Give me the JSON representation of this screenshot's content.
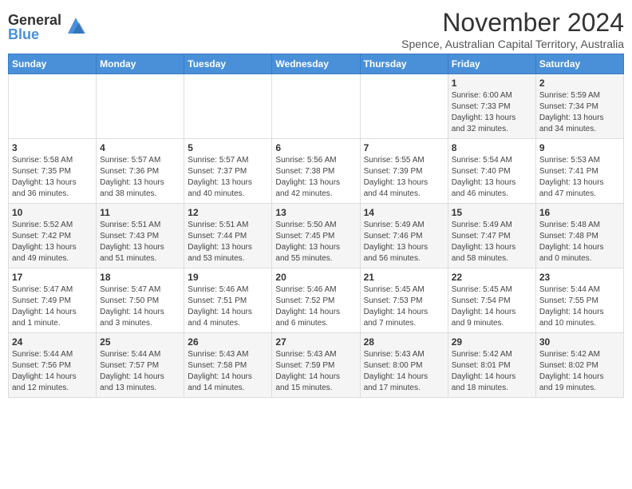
{
  "logo": {
    "general": "General",
    "blue": "Blue"
  },
  "title": "November 2024",
  "location": "Spence, Australian Capital Territory, Australia",
  "days_of_week": [
    "Sunday",
    "Monday",
    "Tuesday",
    "Wednesday",
    "Thursday",
    "Friday",
    "Saturday"
  ],
  "weeks": [
    [
      {
        "day": "",
        "info": ""
      },
      {
        "day": "",
        "info": ""
      },
      {
        "day": "",
        "info": ""
      },
      {
        "day": "",
        "info": ""
      },
      {
        "day": "",
        "info": ""
      },
      {
        "day": "1",
        "info": "Sunrise: 6:00 AM\nSunset: 7:33 PM\nDaylight: 13 hours\nand 32 minutes."
      },
      {
        "day": "2",
        "info": "Sunrise: 5:59 AM\nSunset: 7:34 PM\nDaylight: 13 hours\nand 34 minutes."
      }
    ],
    [
      {
        "day": "3",
        "info": "Sunrise: 5:58 AM\nSunset: 7:35 PM\nDaylight: 13 hours\nand 36 minutes."
      },
      {
        "day": "4",
        "info": "Sunrise: 5:57 AM\nSunset: 7:36 PM\nDaylight: 13 hours\nand 38 minutes."
      },
      {
        "day": "5",
        "info": "Sunrise: 5:57 AM\nSunset: 7:37 PM\nDaylight: 13 hours\nand 40 minutes."
      },
      {
        "day": "6",
        "info": "Sunrise: 5:56 AM\nSunset: 7:38 PM\nDaylight: 13 hours\nand 42 minutes."
      },
      {
        "day": "7",
        "info": "Sunrise: 5:55 AM\nSunset: 7:39 PM\nDaylight: 13 hours\nand 44 minutes."
      },
      {
        "day": "8",
        "info": "Sunrise: 5:54 AM\nSunset: 7:40 PM\nDaylight: 13 hours\nand 46 minutes."
      },
      {
        "day": "9",
        "info": "Sunrise: 5:53 AM\nSunset: 7:41 PM\nDaylight: 13 hours\nand 47 minutes."
      }
    ],
    [
      {
        "day": "10",
        "info": "Sunrise: 5:52 AM\nSunset: 7:42 PM\nDaylight: 13 hours\nand 49 minutes."
      },
      {
        "day": "11",
        "info": "Sunrise: 5:51 AM\nSunset: 7:43 PM\nDaylight: 13 hours\nand 51 minutes."
      },
      {
        "day": "12",
        "info": "Sunrise: 5:51 AM\nSunset: 7:44 PM\nDaylight: 13 hours\nand 53 minutes."
      },
      {
        "day": "13",
        "info": "Sunrise: 5:50 AM\nSunset: 7:45 PM\nDaylight: 13 hours\nand 55 minutes."
      },
      {
        "day": "14",
        "info": "Sunrise: 5:49 AM\nSunset: 7:46 PM\nDaylight: 13 hours\nand 56 minutes."
      },
      {
        "day": "15",
        "info": "Sunrise: 5:49 AM\nSunset: 7:47 PM\nDaylight: 13 hours\nand 58 minutes."
      },
      {
        "day": "16",
        "info": "Sunrise: 5:48 AM\nSunset: 7:48 PM\nDaylight: 14 hours\nand 0 minutes."
      }
    ],
    [
      {
        "day": "17",
        "info": "Sunrise: 5:47 AM\nSunset: 7:49 PM\nDaylight: 14 hours\nand 1 minute."
      },
      {
        "day": "18",
        "info": "Sunrise: 5:47 AM\nSunset: 7:50 PM\nDaylight: 14 hours\nand 3 minutes."
      },
      {
        "day": "19",
        "info": "Sunrise: 5:46 AM\nSunset: 7:51 PM\nDaylight: 14 hours\nand 4 minutes."
      },
      {
        "day": "20",
        "info": "Sunrise: 5:46 AM\nSunset: 7:52 PM\nDaylight: 14 hours\nand 6 minutes."
      },
      {
        "day": "21",
        "info": "Sunrise: 5:45 AM\nSunset: 7:53 PM\nDaylight: 14 hours\nand 7 minutes."
      },
      {
        "day": "22",
        "info": "Sunrise: 5:45 AM\nSunset: 7:54 PM\nDaylight: 14 hours\nand 9 minutes."
      },
      {
        "day": "23",
        "info": "Sunrise: 5:44 AM\nSunset: 7:55 PM\nDaylight: 14 hours\nand 10 minutes."
      }
    ],
    [
      {
        "day": "24",
        "info": "Sunrise: 5:44 AM\nSunset: 7:56 PM\nDaylight: 14 hours\nand 12 minutes."
      },
      {
        "day": "25",
        "info": "Sunrise: 5:44 AM\nSunset: 7:57 PM\nDaylight: 14 hours\nand 13 minutes."
      },
      {
        "day": "26",
        "info": "Sunrise: 5:43 AM\nSunset: 7:58 PM\nDaylight: 14 hours\nand 14 minutes."
      },
      {
        "day": "27",
        "info": "Sunrise: 5:43 AM\nSunset: 7:59 PM\nDaylight: 14 hours\nand 15 minutes."
      },
      {
        "day": "28",
        "info": "Sunrise: 5:43 AM\nSunset: 8:00 PM\nDaylight: 14 hours\nand 17 minutes."
      },
      {
        "day": "29",
        "info": "Sunrise: 5:42 AM\nSunset: 8:01 PM\nDaylight: 14 hours\nand 18 minutes."
      },
      {
        "day": "30",
        "info": "Sunrise: 5:42 AM\nSunset: 8:02 PM\nDaylight: 14 hours\nand 19 minutes."
      }
    ]
  ]
}
